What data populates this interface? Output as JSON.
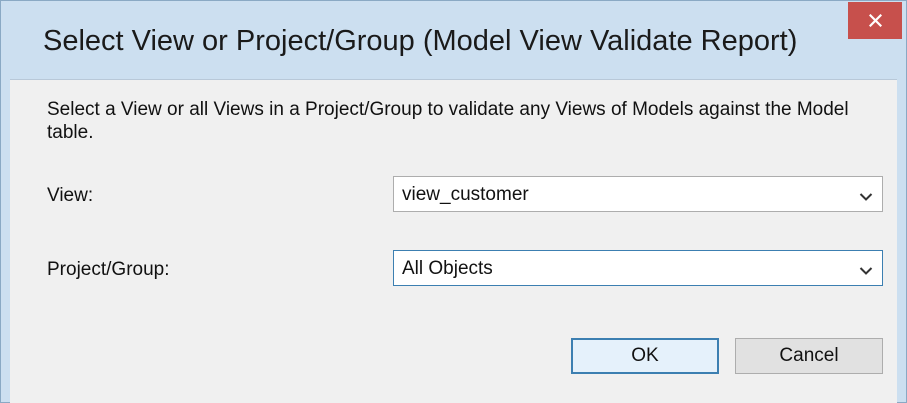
{
  "window": {
    "title": "Select View or Project/Group (Model View Validate Report)",
    "close_icon": "close-icon",
    "accent_close": "#c7504c"
  },
  "dialog": {
    "description": "Select a View or all Views in a Project/Group to validate any Views of Models against the Model table.",
    "fields": {
      "view": {
        "label": "View:",
        "value": "view_customer"
      },
      "project_group": {
        "label": "Project/Group:",
        "value": "All Objects"
      }
    },
    "buttons": {
      "ok": "OK",
      "cancel": "Cancel"
    }
  }
}
